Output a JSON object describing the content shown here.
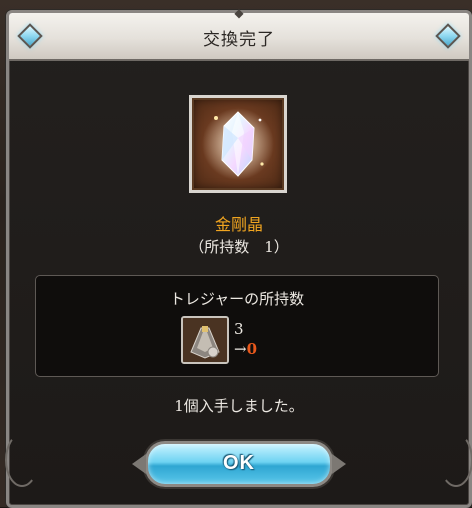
{
  "dialog": {
    "title": "交換完了"
  },
  "item": {
    "name": "金剛晶",
    "owned_text": "（所持数　1）",
    "icon": "crystal-icon"
  },
  "treasure": {
    "title": "トレジャーの所持数",
    "icon": "treasure-icon",
    "count_before": "3",
    "arrow": "→",
    "count_after": "0"
  },
  "message": "1個入手しました。",
  "ok_button": {
    "label": "OK"
  },
  "colors": {
    "item_name": "#f0a520",
    "count_after": "#e8581c",
    "button_accent": "#4fbfe6"
  }
}
